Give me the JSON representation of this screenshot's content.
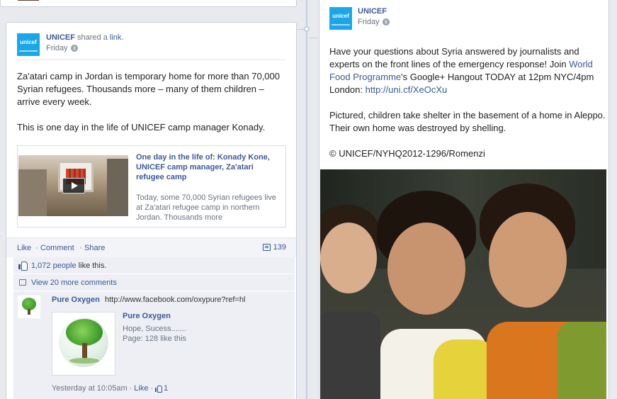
{
  "left_post": {
    "avatar_text": "unicef",
    "author": "UNICEF",
    "shared_prefix": " shared a ",
    "shared_link": "link",
    "shared_suffix": ".",
    "time": "Friday",
    "text_p1": "Za'atari camp in Jordan is temporary home for more than 70,000 Syrian refugees. Thousands more – many of them children – arrive every week.",
    "text_p2": "This is one day in the life of UNICEF camp manager Konady.",
    "preview": {
      "title": "One day in the life of: Konady Kone, UNICEF camp manager, Za'atari refugee camp",
      "description": "Today, some 70,000 Syrian refugees live at Za'atari refugee camp in northern Jordan. Thousands more"
    },
    "actions": {
      "like": "Like",
      "comment": "Comment",
      "share": "Share",
      "sep": "·",
      "comment_count": "139"
    },
    "likes": {
      "count_link": "1,072 people",
      "suffix": " like this."
    },
    "view_more": "View 20 more comments",
    "comment": {
      "author": "Pure Oxygen",
      "text": "http://www.facebook.com/oxypure?ref=hl",
      "preview_title": "Pure Oxygen",
      "preview_line1": "Hope, Sucess.......",
      "preview_line2": "Page: 128 like this",
      "timestamp": "Yesterday at 10:05am",
      "sep": "·",
      "like": "Like",
      "like_count": "1"
    }
  },
  "right_post": {
    "avatar_text": "unicef",
    "author": "UNICEF",
    "time": "Friday",
    "text_l1": "Have your questions about Syria answered by journalists and experts on the front lines of the emergency response! Join ",
    "text_link1": "World Food Programme",
    "text_l2": "'s Google+ Hangout TODAY at 12pm NYC/4pm London: ",
    "text_link2": "http://uni.cf/XeOcXu",
    "text_p2": "Pictured, children take shelter in the basement of a home in Aleppo. Their own home was destroyed by shelling.",
    "text_p3": "© UNICEF/NYHQ2012-1296/Romenzi"
  },
  "colors": {
    "link": "#3b5998",
    "unicef_blue": "#1aa7e8",
    "page_bg": "#e9eaed"
  }
}
